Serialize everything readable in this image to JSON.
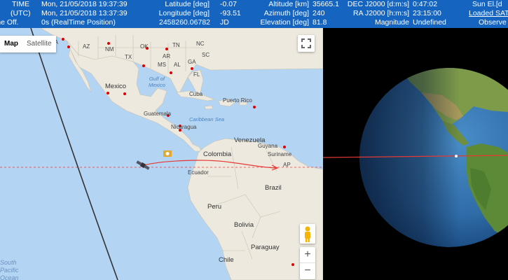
{
  "header": {
    "time_label": "TIME",
    "utc_label": "(UTC)",
    "offset_label": "Time Off.",
    "local_time": "Mon, 21/05/2018 19:37:39",
    "utc_time": "Mon, 21/05/2018 13:37:39",
    "offset_value": "0s (RealTime Position)",
    "latitude_label": "Latitude [deg]",
    "latitude_value": "-0.07",
    "longitude_label": "Longitude [deg]",
    "longitude_value": "-93.51",
    "jd_value": "2458260.06782",
    "jd_label": "JD",
    "altitude_value": "35665.1",
    "altitude_label": "Altitude [km]",
    "azimuth_label": "Azimuth [deg]",
    "azimuth_value": "240",
    "elevation_label": "Elevation [deg]",
    "elevation_value": "81.8",
    "dec_label": "DEC J2000 [d:m:s]",
    "dec_value": "0:47:02",
    "ra_label": "RA J2000 [h:m:s]",
    "ra_value": "23:15:00",
    "magnitude_label": "Magnitude",
    "magnitude_value": "Undefined",
    "sun_el_label": "Sun El.[d",
    "loaded_label": "Loaded SAT",
    "observer_label": "Observe"
  },
  "map": {
    "maptype_map": "Map",
    "maptype_satellite": "Satellite",
    "zoom_in": "+",
    "zoom_out": "−",
    "fullscreen_icon": "fullscreen-icon",
    "pegman_icon": "pegman-icon",
    "labels": {
      "mexico": "Mexico",
      "gulf": "Gulf of\nMexico",
      "cuba": "Cuba",
      "puerto_rico": "Puerto Rico",
      "guatemala": "Guatemala",
      "caribbean": "Caribbean Sea",
      "nicaragua": "Nicaragua",
      "venezuela": "Venezuela",
      "colombia": "Colombia",
      "guyana": "Guyana",
      "suriname": "Suriname",
      "ap": "AP",
      "ecuador": "Ecuador",
      "brazil": "Brazil",
      "peru": "Peru",
      "bolivia": "Bolivia",
      "paraguay": "Paraguay",
      "chile": "Chile",
      "south": "South",
      "pacific": "Pacific",
      "ocean": "Ocean",
      "az": "AZ",
      "nm": "NM",
      "tx": "TX",
      "ok": "OK",
      "ar": "AR",
      "ms": "MS",
      "al": "AL",
      "tn": "TN",
      "nc": "NC",
      "ga": "GA",
      "fl": "FL",
      "sc": "SC",
      "ca": "CA"
    }
  },
  "colors": {
    "header_bg": "#1565c0",
    "ocean": "#b3d4f2",
    "land": "#ede9df",
    "track": "#e53935",
    "marker": "#e00000"
  }
}
